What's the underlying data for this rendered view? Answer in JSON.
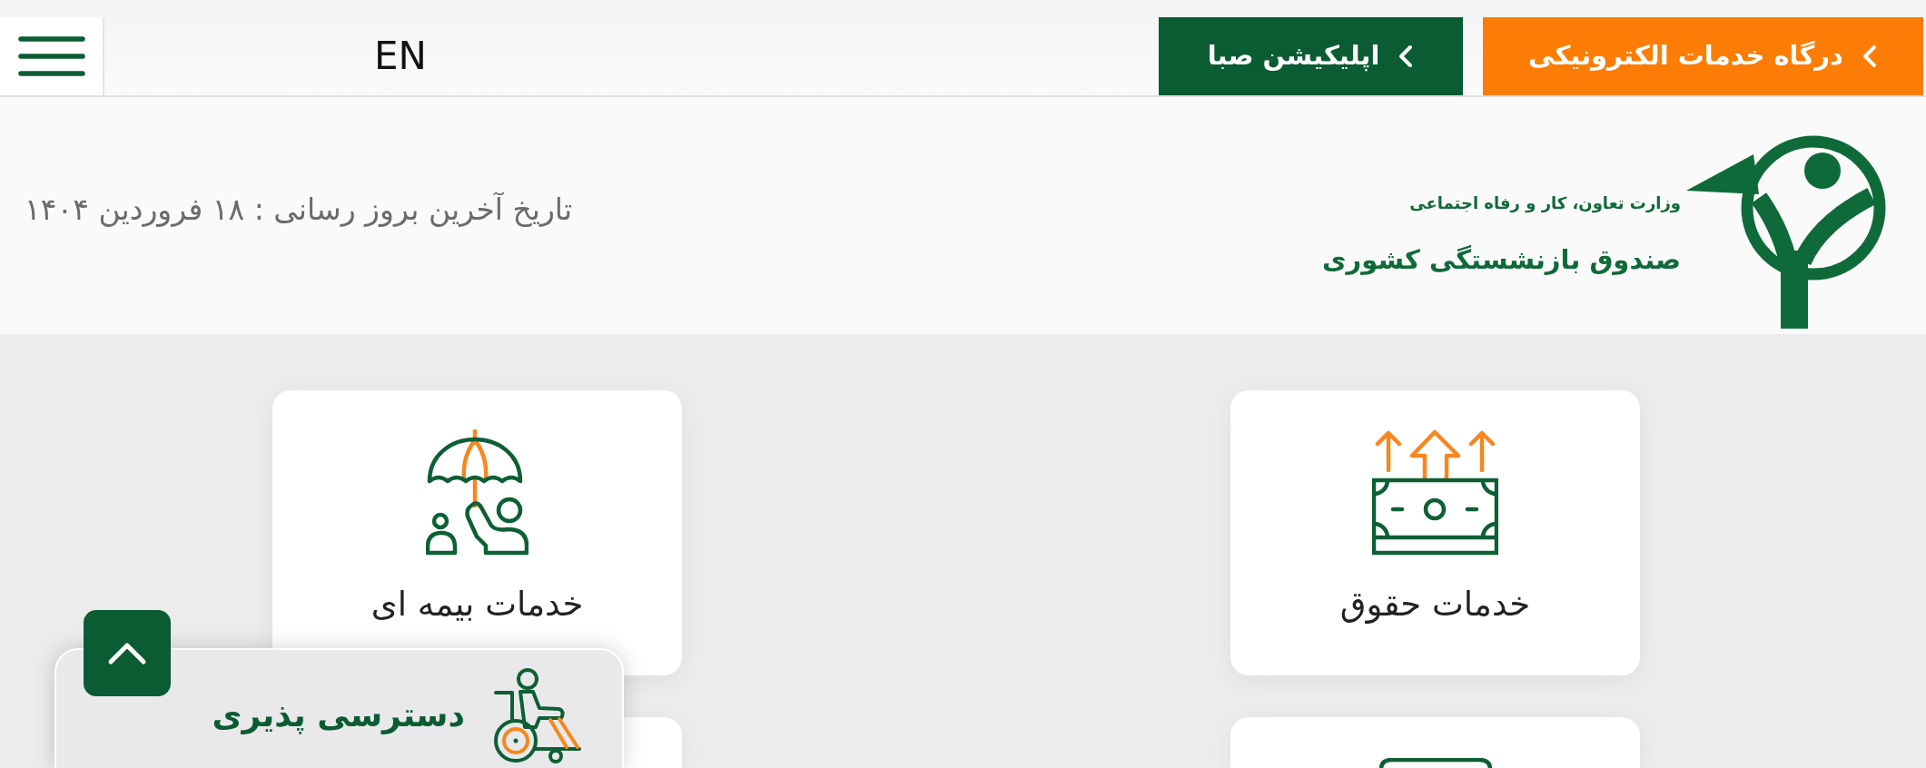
{
  "top_bar": {
    "language": "EN",
    "links": [
      {
        "label": "درگاه خدمات الکترونیکی",
        "color": "#fb7d05"
      },
      {
        "label": "اپلیکیشن صبا",
        "color": "#0b5c33"
      }
    ]
  },
  "header": {
    "ministry": "وزارت تعاون، کار و رفاه اجتماعی",
    "fund_name": "صندوق بازنشستگی کشوری",
    "last_update": "تاریخ آخرین بروز رسانی : ۱۸ فروردین ۱۴۰۴"
  },
  "services": [
    {
      "label": "خدمات حقوق"
    },
    {
      "label": "خدمات بیمه ای"
    }
  ],
  "accessibility": {
    "label": "دسترسی پذیری"
  }
}
